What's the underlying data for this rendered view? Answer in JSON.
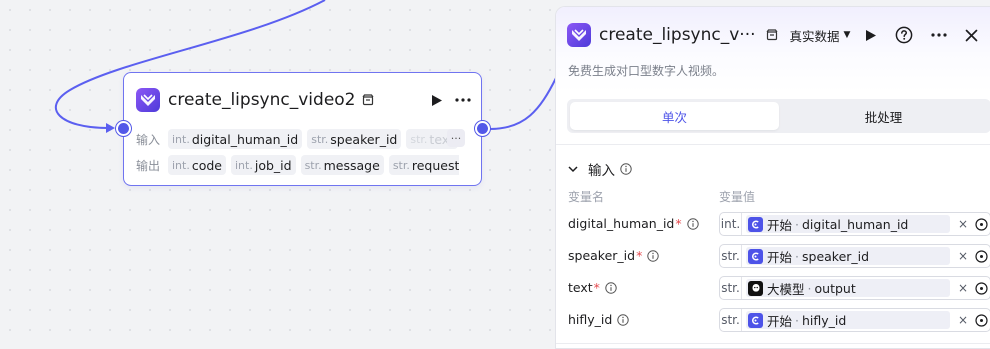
{
  "node": {
    "title": "create_lipsync_video2",
    "input_label": "输入",
    "output_label": "输出",
    "inputs": [
      {
        "type": "int.",
        "name": "digital_human_id"
      },
      {
        "type": "str.",
        "name": "speaker_id"
      },
      {
        "type": "str.",
        "name": "text"
      }
    ],
    "more_label": "···",
    "outputs": [
      {
        "type": "int.",
        "name": "code"
      },
      {
        "type": "int.",
        "name": "job_id"
      },
      {
        "type": "str.",
        "name": "message"
      },
      {
        "type": "str.",
        "name": "request_id"
      }
    ]
  },
  "panel": {
    "title": "create_lipsync_v···",
    "data_source": "真实数据",
    "description": "免费生成对口型数字人视频。",
    "tabs": [
      {
        "label": "单次",
        "active": true
      },
      {
        "label": "批处理",
        "active": false
      }
    ],
    "section_title": "输入",
    "col_name": "变量名",
    "col_value": "变量值",
    "params": [
      {
        "name": "digital_human_id",
        "required": true,
        "type": "int.",
        "source": "开始",
        "field": "digital_human_id",
        "source_icon": "start-node-icon"
      },
      {
        "name": "speaker_id",
        "required": true,
        "type": "str.",
        "source": "开始",
        "field": "speaker_id",
        "source_icon": "start-node-icon"
      },
      {
        "name": "text",
        "required": true,
        "type": "str.",
        "source": "大模型",
        "field": "output",
        "source_icon": "llm-node-icon"
      },
      {
        "name": "hifly_id",
        "required": false,
        "type": "str.",
        "source": "开始",
        "field": "hifly_id",
        "source_icon": "start-node-icon"
      }
    ]
  },
  "colors": {
    "accent": "#4d53e8",
    "edge": "#5b5ff0",
    "required": "#e5484d"
  }
}
